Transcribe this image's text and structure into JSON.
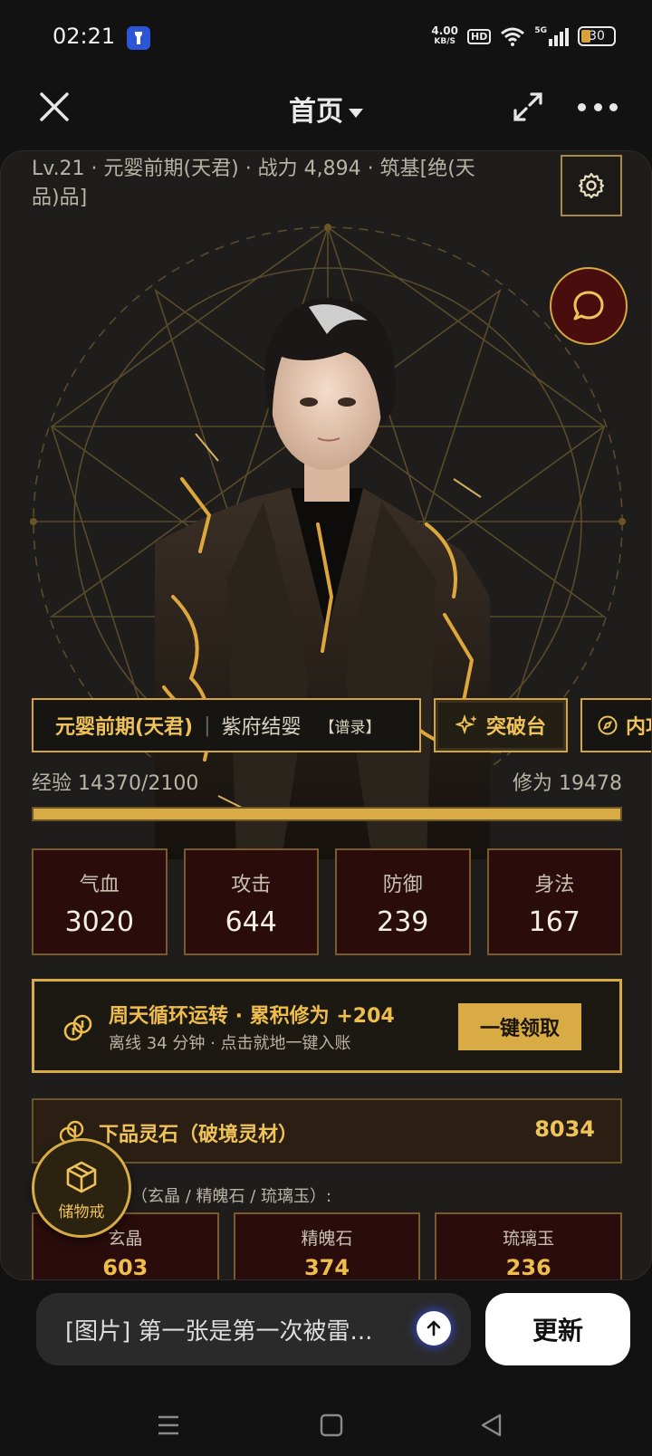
{
  "status_bar": {
    "time": "02:21",
    "net_speed_value": "4.00",
    "net_speed_unit": "KB/S",
    "hd": "HD",
    "signal": "5G",
    "battery": "30"
  },
  "header": {
    "title": "首页"
  },
  "profile": {
    "info": "Lv.21 · 元婴前期(天君) · 战力 4,894 · 筑基[绝(天品)品]"
  },
  "realm": {
    "main": "元婴前期(天君)",
    "separator": "|",
    "sub": "紫府结婴",
    "record": "【谱录】",
    "breakthrough_label": "突破台",
    "inner_label": "内功"
  },
  "progress": {
    "exp_text": "经验 14370/2100",
    "cultivation_text": "修为 19478",
    "exp_fill_fraction": 1.0
  },
  "stats": [
    {
      "label": "气血",
      "value": "3020"
    },
    {
      "label": "攻击",
      "value": "644"
    },
    {
      "label": "防御",
      "value": "239"
    },
    {
      "label": "身法",
      "value": "167"
    }
  ],
  "claim": {
    "title": "周天循环运转 · 累积修为 +204",
    "subtitle": "离线 34 分钟 · 点击就地一键入账",
    "button": "一键领取"
  },
  "spirit_stone": {
    "label": "下品灵石（破境灵材）",
    "value": "8034"
  },
  "materials": {
    "label": "材（玄晶 / 精魄石 / 琉璃玉）:",
    "items": [
      {
        "name": "玄晶",
        "value": "603"
      },
      {
        "name": "精魄石",
        "value": "374"
      },
      {
        "name": "琉璃玉",
        "value": "236"
      }
    ]
  },
  "storage_ring": {
    "label": "储物戒"
  },
  "composer": {
    "text": "[图片] 第一张是第一次被雷...",
    "update_button": "更新"
  },
  "colors": {
    "gold": "#d9ab45",
    "dark_red": "#2a0c0c",
    "background": "#121212"
  },
  "icons": [
    "close-icon",
    "caret-down-icon",
    "expand-icon",
    "more-icon",
    "gear-icon",
    "chat-bubble-icon",
    "sparkle-icon",
    "compass-icon",
    "coins-icon",
    "box-icon",
    "arrow-up-icon",
    "menu-icon",
    "home-icon",
    "back-icon"
  ]
}
